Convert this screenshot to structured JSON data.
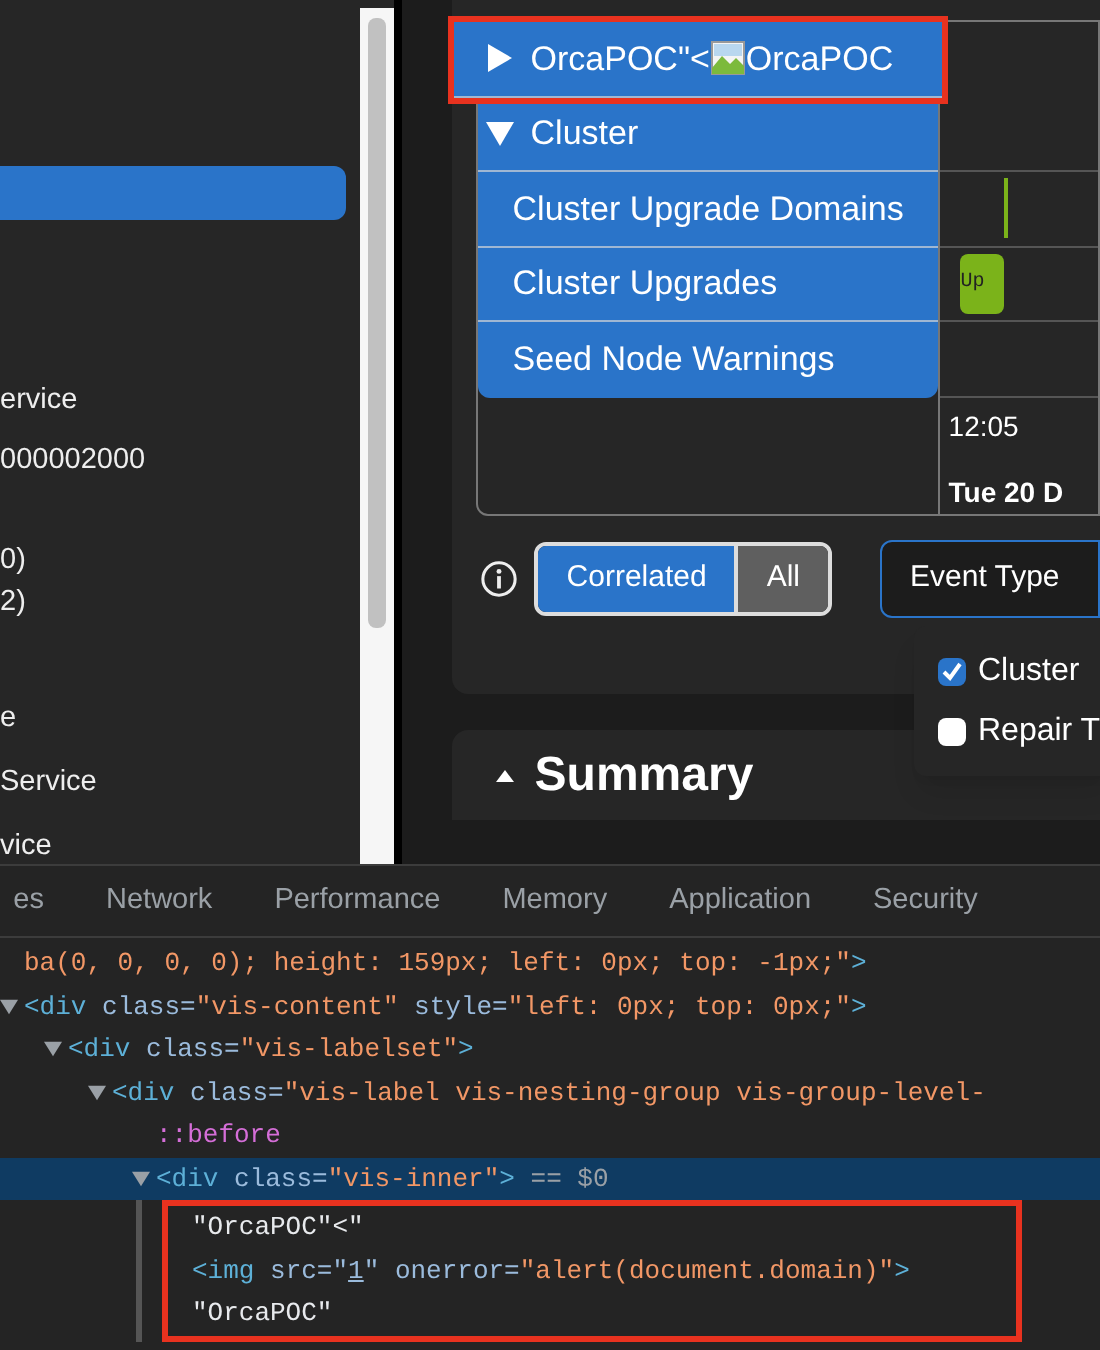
{
  "sidebar": {
    "items": [
      {
        "selected": true
      },
      {
        "label": "ervice",
        "selected": false
      },
      {
        "label": "000002000",
        "selected": false
      },
      {
        "label": "0)",
        "selected": false
      },
      {
        "label": "2)",
        "selected": false
      },
      {
        "label": "e",
        "selected": false
      },
      {
        "label": "Service",
        "selected": false
      },
      {
        "label": "vice",
        "selected": false
      }
    ]
  },
  "timeline": {
    "groups": [
      {
        "kind": "injected",
        "text_before_image": "OrcaPOC\"<",
        "text_after_image": "OrcaPOC",
        "expanded": false,
        "highlighted": true
      },
      {
        "kind": "parent",
        "label": "Cluster",
        "expanded": true,
        "highlighted": false,
        "children": [
          {
            "label": "Cluster Upgrade Domains"
          },
          {
            "label": "Cluster Upgrades",
            "item": "Up"
          },
          {
            "label": "Seed Node Warnings"
          }
        ]
      }
    ],
    "axis": {
      "minor": "12:05",
      "major": "Tue 20 D"
    }
  },
  "filter": {
    "options": [
      {
        "label": "Correlated",
        "selected": true
      },
      {
        "label": "All",
        "selected": false
      }
    ]
  },
  "event_type": {
    "label": "Event Type",
    "items": [
      {
        "label": "Cluster",
        "checked": true
      },
      {
        "label": "Repair T",
        "checked": false
      }
    ]
  },
  "summary": {
    "title": "Summary"
  },
  "devtools": {
    "tabs": [
      "es",
      "Network",
      "Performance",
      "Memory",
      "Application",
      "Security"
    ],
    "nodes": [
      {
        "tokens": [
          {
            "kind": "value",
            "t": "ba(0, 0, 0, 0); height: 159px; left: 0px; top: -1px;\""
          },
          {
            "kind": "tag",
            "t": ">"
          }
        ]
      },
      {
        "expanded": true,
        "tokens": [
          {
            "kind": "tag",
            "t": "<div"
          },
          {
            "kind": "attr",
            "t": " class="
          },
          {
            "kind": "value",
            "t": "\"vis-content\""
          },
          {
            "kind": "attr",
            "t": " style="
          },
          {
            "kind": "value",
            "t": "\"left: 0px; top: 0px;\""
          },
          {
            "kind": "tag",
            "t": ">"
          }
        ],
        "children": [
          {
            "expanded": true,
            "tokens": [
              {
                "kind": "tag",
                "t": "<div"
              },
              {
                "kind": "attr",
                "t": " class="
              },
              {
                "kind": "value",
                "t": "\"vis-labelset\""
              },
              {
                "kind": "tag",
                "t": ">"
              }
            ],
            "children": [
              {
                "expanded": true,
                "tokens": [
                  {
                    "kind": "tag",
                    "t": "<div"
                  },
                  {
                    "kind": "attr",
                    "t": " class="
                  },
                  {
                    "kind": "value",
                    "t": "\"vis-label vis-nesting-group vis-group-level-"
                  }
                ],
                "children": [
                  {
                    "tokens": [
                      {
                        "kind": "pseudo",
                        "t": "::before"
                      }
                    ]
                  },
                  {
                    "expanded": true,
                    "selected": true,
                    "highlight_children": true,
                    "tokens": [
                      {
                        "kind": "tag",
                        "t": "<div"
                      },
                      {
                        "kind": "attr",
                        "t": " class="
                      },
                      {
                        "kind": "value",
                        "t": "\"vis-inner\""
                      },
                      {
                        "kind": "tag",
                        "t": ">"
                      },
                      {
                        "kind": "ref",
                        "t": " == $0"
                      }
                    ],
                    "children": [
                      {
                        "tokens": [
                          {
                            "kind": "text",
                            "t": "\"OrcaPOC\"<\""
                          }
                        ]
                      },
                      {
                        "tokens": [
                          {
                            "kind": "tag",
                            "t": "<img"
                          },
                          {
                            "kind": "attr",
                            "t": " src=\""
                          },
                          {
                            "kind": "link",
                            "t": "1"
                          },
                          {
                            "kind": "attr",
                            "t": "\" onerror="
                          },
                          {
                            "kind": "value",
                            "t": "\"alert(document.domain)\""
                          },
                          {
                            "kind": "tag",
                            "t": ">"
                          }
                        ]
                      },
                      {
                        "tokens": [
                          {
                            "kind": "text",
                            "t": "\"OrcaPOC\""
                          }
                        ]
                      }
                    ]
                  }
                ]
              }
            ]
          }
        ]
      }
    ]
  }
}
